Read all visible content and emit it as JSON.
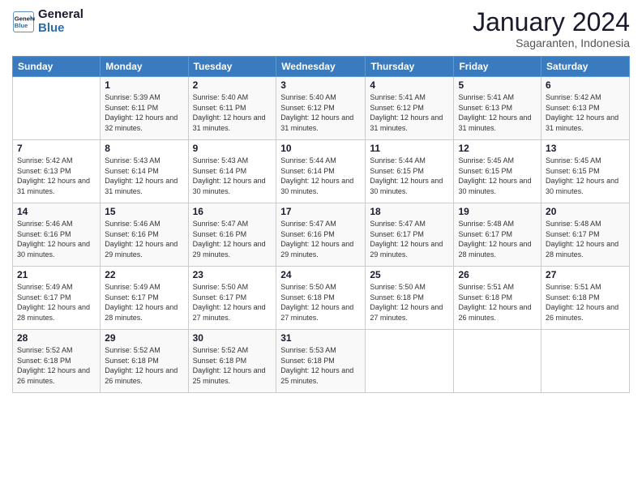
{
  "logo": {
    "line1": "General",
    "line2": "Blue"
  },
  "title": "January 2024",
  "location": "Sagaranten, Indonesia",
  "days_of_week": [
    "Sunday",
    "Monday",
    "Tuesday",
    "Wednesday",
    "Thursday",
    "Friday",
    "Saturday"
  ],
  "weeks": [
    [
      {
        "num": "",
        "sunrise": "",
        "sunset": "",
        "daylight": ""
      },
      {
        "num": "1",
        "sunrise": "Sunrise: 5:39 AM",
        "sunset": "Sunset: 6:11 PM",
        "daylight": "Daylight: 12 hours and 32 minutes."
      },
      {
        "num": "2",
        "sunrise": "Sunrise: 5:40 AM",
        "sunset": "Sunset: 6:11 PM",
        "daylight": "Daylight: 12 hours and 31 minutes."
      },
      {
        "num": "3",
        "sunrise": "Sunrise: 5:40 AM",
        "sunset": "Sunset: 6:12 PM",
        "daylight": "Daylight: 12 hours and 31 minutes."
      },
      {
        "num": "4",
        "sunrise": "Sunrise: 5:41 AM",
        "sunset": "Sunset: 6:12 PM",
        "daylight": "Daylight: 12 hours and 31 minutes."
      },
      {
        "num": "5",
        "sunrise": "Sunrise: 5:41 AM",
        "sunset": "Sunset: 6:13 PM",
        "daylight": "Daylight: 12 hours and 31 minutes."
      },
      {
        "num": "6",
        "sunrise": "Sunrise: 5:42 AM",
        "sunset": "Sunset: 6:13 PM",
        "daylight": "Daylight: 12 hours and 31 minutes."
      }
    ],
    [
      {
        "num": "7",
        "sunrise": "Sunrise: 5:42 AM",
        "sunset": "Sunset: 6:13 PM",
        "daylight": "Daylight: 12 hours and 31 minutes."
      },
      {
        "num": "8",
        "sunrise": "Sunrise: 5:43 AM",
        "sunset": "Sunset: 6:14 PM",
        "daylight": "Daylight: 12 hours and 31 minutes."
      },
      {
        "num": "9",
        "sunrise": "Sunrise: 5:43 AM",
        "sunset": "Sunset: 6:14 PM",
        "daylight": "Daylight: 12 hours and 30 minutes."
      },
      {
        "num": "10",
        "sunrise": "Sunrise: 5:44 AM",
        "sunset": "Sunset: 6:14 PM",
        "daylight": "Daylight: 12 hours and 30 minutes."
      },
      {
        "num": "11",
        "sunrise": "Sunrise: 5:44 AM",
        "sunset": "Sunset: 6:15 PM",
        "daylight": "Daylight: 12 hours and 30 minutes."
      },
      {
        "num": "12",
        "sunrise": "Sunrise: 5:45 AM",
        "sunset": "Sunset: 6:15 PM",
        "daylight": "Daylight: 12 hours and 30 minutes."
      },
      {
        "num": "13",
        "sunrise": "Sunrise: 5:45 AM",
        "sunset": "Sunset: 6:15 PM",
        "daylight": "Daylight: 12 hours and 30 minutes."
      }
    ],
    [
      {
        "num": "14",
        "sunrise": "Sunrise: 5:46 AM",
        "sunset": "Sunset: 6:16 PM",
        "daylight": "Daylight: 12 hours and 30 minutes."
      },
      {
        "num": "15",
        "sunrise": "Sunrise: 5:46 AM",
        "sunset": "Sunset: 6:16 PM",
        "daylight": "Daylight: 12 hours and 29 minutes."
      },
      {
        "num": "16",
        "sunrise": "Sunrise: 5:47 AM",
        "sunset": "Sunset: 6:16 PM",
        "daylight": "Daylight: 12 hours and 29 minutes."
      },
      {
        "num": "17",
        "sunrise": "Sunrise: 5:47 AM",
        "sunset": "Sunset: 6:16 PM",
        "daylight": "Daylight: 12 hours and 29 minutes."
      },
      {
        "num": "18",
        "sunrise": "Sunrise: 5:47 AM",
        "sunset": "Sunset: 6:17 PM",
        "daylight": "Daylight: 12 hours and 29 minutes."
      },
      {
        "num": "19",
        "sunrise": "Sunrise: 5:48 AM",
        "sunset": "Sunset: 6:17 PM",
        "daylight": "Daylight: 12 hours and 28 minutes."
      },
      {
        "num": "20",
        "sunrise": "Sunrise: 5:48 AM",
        "sunset": "Sunset: 6:17 PM",
        "daylight": "Daylight: 12 hours and 28 minutes."
      }
    ],
    [
      {
        "num": "21",
        "sunrise": "Sunrise: 5:49 AM",
        "sunset": "Sunset: 6:17 PM",
        "daylight": "Daylight: 12 hours and 28 minutes."
      },
      {
        "num": "22",
        "sunrise": "Sunrise: 5:49 AM",
        "sunset": "Sunset: 6:17 PM",
        "daylight": "Daylight: 12 hours and 28 minutes."
      },
      {
        "num": "23",
        "sunrise": "Sunrise: 5:50 AM",
        "sunset": "Sunset: 6:17 PM",
        "daylight": "Daylight: 12 hours and 27 minutes."
      },
      {
        "num": "24",
        "sunrise": "Sunrise: 5:50 AM",
        "sunset": "Sunset: 6:18 PM",
        "daylight": "Daylight: 12 hours and 27 minutes."
      },
      {
        "num": "25",
        "sunrise": "Sunrise: 5:50 AM",
        "sunset": "Sunset: 6:18 PM",
        "daylight": "Daylight: 12 hours and 27 minutes."
      },
      {
        "num": "26",
        "sunrise": "Sunrise: 5:51 AM",
        "sunset": "Sunset: 6:18 PM",
        "daylight": "Daylight: 12 hours and 26 minutes."
      },
      {
        "num": "27",
        "sunrise": "Sunrise: 5:51 AM",
        "sunset": "Sunset: 6:18 PM",
        "daylight": "Daylight: 12 hours and 26 minutes."
      }
    ],
    [
      {
        "num": "28",
        "sunrise": "Sunrise: 5:52 AM",
        "sunset": "Sunset: 6:18 PM",
        "daylight": "Daylight: 12 hours and 26 minutes."
      },
      {
        "num": "29",
        "sunrise": "Sunrise: 5:52 AM",
        "sunset": "Sunset: 6:18 PM",
        "daylight": "Daylight: 12 hours and 26 minutes."
      },
      {
        "num": "30",
        "sunrise": "Sunrise: 5:52 AM",
        "sunset": "Sunset: 6:18 PM",
        "daylight": "Daylight: 12 hours and 25 minutes."
      },
      {
        "num": "31",
        "sunrise": "Sunrise: 5:53 AM",
        "sunset": "Sunset: 6:18 PM",
        "daylight": "Daylight: 12 hours and 25 minutes."
      },
      {
        "num": "",
        "sunrise": "",
        "sunset": "",
        "daylight": ""
      },
      {
        "num": "",
        "sunrise": "",
        "sunset": "",
        "daylight": ""
      },
      {
        "num": "",
        "sunrise": "",
        "sunset": "",
        "daylight": ""
      }
    ]
  ]
}
